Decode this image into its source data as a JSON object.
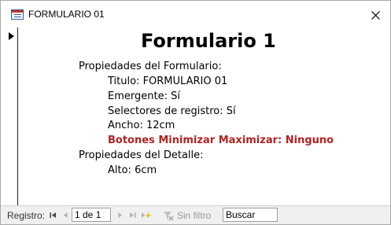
{
  "window": {
    "title": "FORMULARIO 01",
    "icons": {
      "app": "form-icon",
      "close": "close-icon"
    }
  },
  "form": {
    "heading": "Formulario 1",
    "lines": [
      {
        "text": "Propiedades del Formulario:",
        "indent": 0,
        "highlight": false
      },
      {
        "text": "Titulo: FORMULARIO 01",
        "indent": 1,
        "highlight": false
      },
      {
        "text": "Emergente: Sí",
        "indent": 1,
        "highlight": false
      },
      {
        "text": "Selectores de registro: Sí",
        "indent": 1,
        "highlight": false
      },
      {
        "text": "Ancho: 12cm",
        "indent": 1,
        "highlight": false
      },
      {
        "text": "Botones Minimizar Maximizar: Ninguno",
        "indent": 1,
        "highlight": true
      },
      {
        "text": "Propiedades del Detalle:",
        "indent": 0,
        "highlight": false
      },
      {
        "text": "Alto: 6cm",
        "indent": 1,
        "highlight": false
      }
    ],
    "highlight_color": "#b22222"
  },
  "navigation": {
    "record_label": "Registro:",
    "current_record": "1 de 1",
    "filter_label": "Sin filtro",
    "search_placeholder": "Buscar"
  }
}
